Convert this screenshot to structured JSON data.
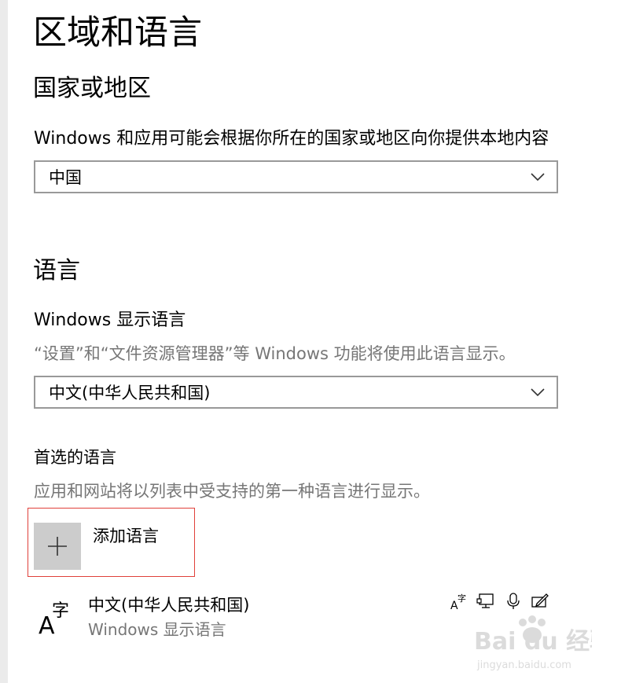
{
  "page": {
    "title": "区域和语言"
  },
  "region": {
    "heading": "国家或地区",
    "description": "Windows 和应用可能会根据你所在的国家或地区向你提供本地内容",
    "selected": "中国"
  },
  "language": {
    "heading": "语言",
    "display_label": "Windows 显示语言",
    "display_description": "“设置”和“文件资源管理器”等 Windows 功能将使用此语言显示。",
    "display_selected": "中文(中华人民共和国)",
    "preferred_heading": "首选的语言",
    "preferred_description": "应用和网站将以列表中受支持的第一种语言进行显示。",
    "add_label": "添加语言",
    "items": [
      {
        "name": "中文(中华人民共和国)",
        "sub": "Windows 显示语言",
        "icon": "language-icon",
        "features": [
          "display-language-icon",
          "text-to-speech-icon",
          "speech-recognition-icon",
          "handwriting-icon"
        ]
      }
    ]
  },
  "watermark": {
    "brand": "Bai du 经验",
    "url": "jingyan.baidu.com"
  },
  "colors": {
    "highlight_frame": "#e0403a",
    "add_tile": "#cccccc",
    "select_border": "#999999",
    "secondary_text": "#767676"
  }
}
